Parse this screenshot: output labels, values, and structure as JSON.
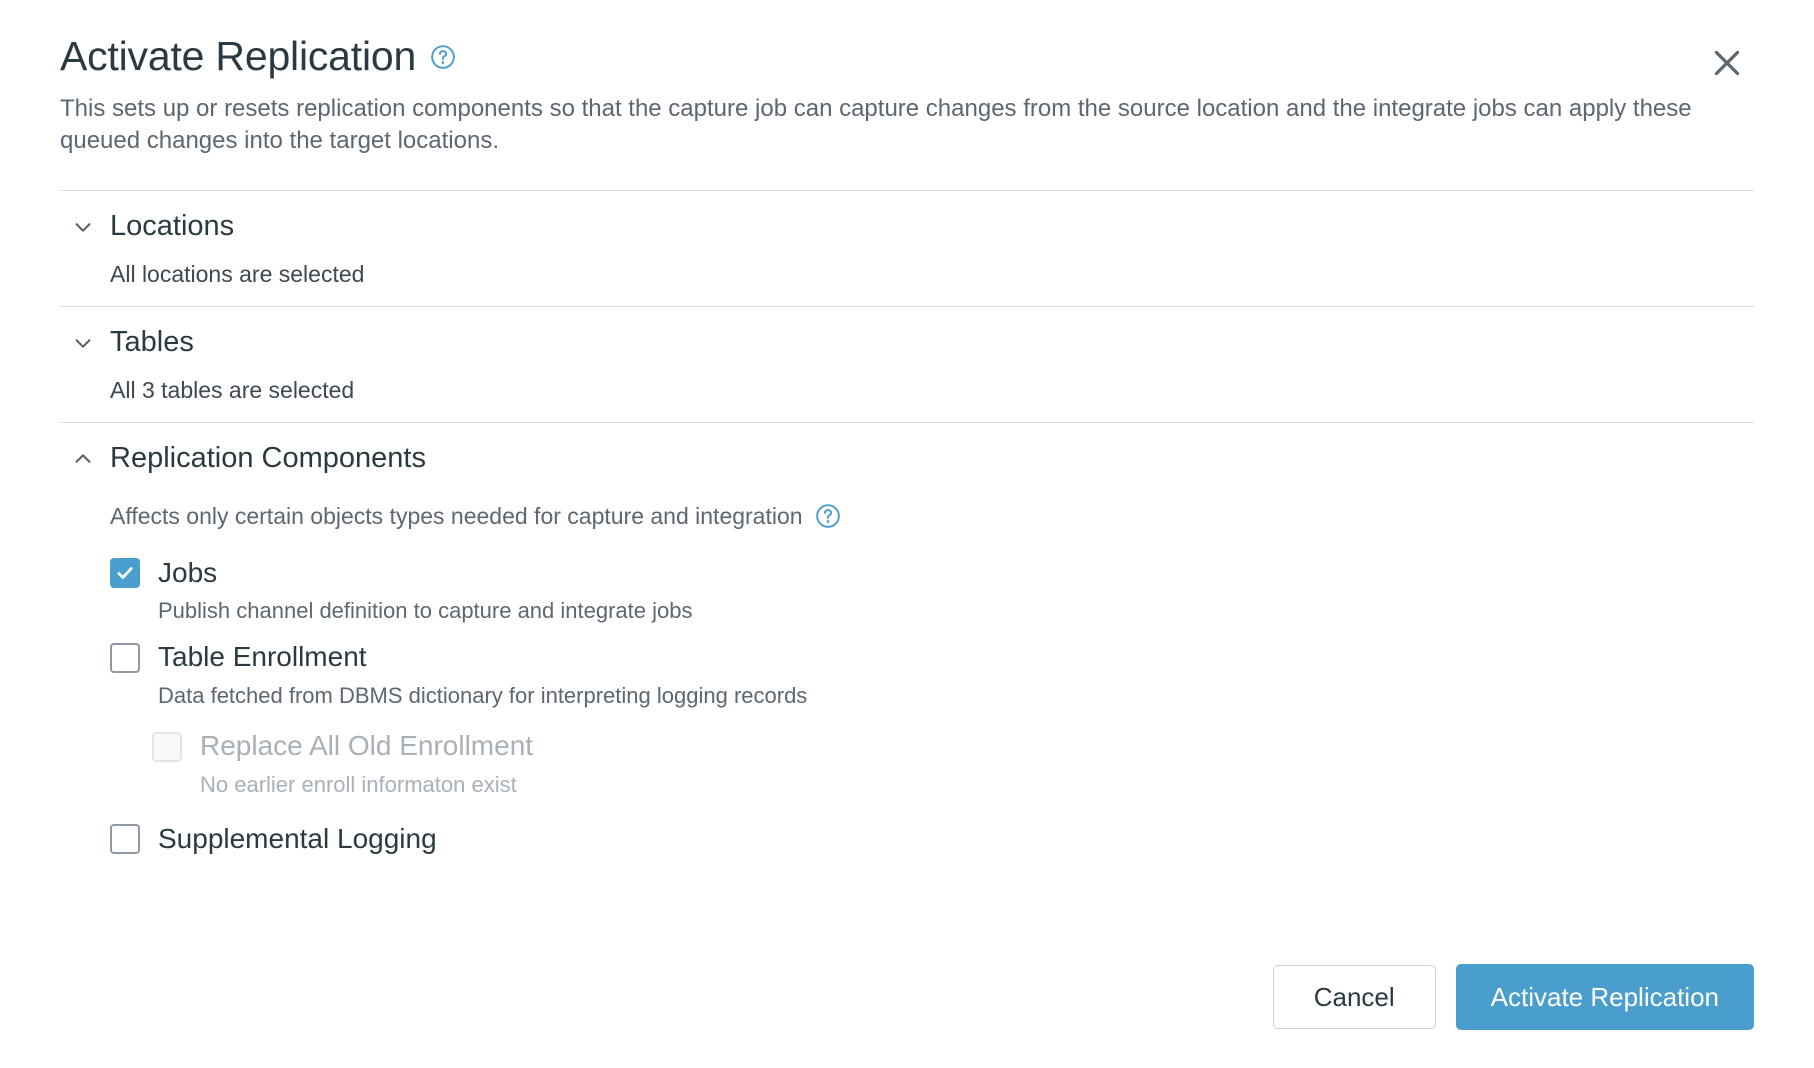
{
  "dialog": {
    "title": "Activate Replication",
    "title_help_icon": "help-circle-icon",
    "close_icon": "close-icon",
    "description": "This sets up or resets replication components so that the capture job can capture changes from the source location and the integrate jobs can apply these queued changes into the target locations."
  },
  "sections": [
    {
      "key": "locations",
      "title": "Locations",
      "chevron": "chevron-down-icon",
      "expanded": false,
      "summary": "All locations are selected"
    },
    {
      "key": "tables",
      "title": "Tables",
      "chevron": "chevron-down-icon",
      "expanded": false,
      "summary": "All 3 tables are selected"
    },
    {
      "key": "replication_components",
      "title": "Replication Components",
      "chevron": "chevron-up-icon",
      "expanded": true,
      "summary": "Affects only certain objects types needed for capture and integration",
      "summary_help_icon": "help-circle-icon"
    }
  ],
  "components": {
    "jobs": {
      "label": "Jobs",
      "checked": true,
      "help": "Publish channel definition to capture and integrate jobs"
    },
    "table_enrollment": {
      "label": "Table Enrollment",
      "checked": false,
      "help": "Data fetched from DBMS dictionary for interpreting logging records"
    },
    "replace_all_old_enrollment": {
      "label": "Replace All Old Enrollment",
      "checked": false,
      "disabled": true,
      "help": "No earlier enroll informaton exist"
    },
    "supplemental_logging": {
      "label": "Supplemental Logging",
      "checked": false
    }
  },
  "footer": {
    "cancel_label": "Cancel",
    "submit_label": "Activate Replication"
  },
  "colors": {
    "accent": "#4a9ecd",
    "help_icon": "#4a9ecd",
    "title_text": "#2b3a42",
    "muted_text": "#5c6771",
    "disabled_text": "#a8b0b8",
    "divider": "#dcdfe2"
  }
}
